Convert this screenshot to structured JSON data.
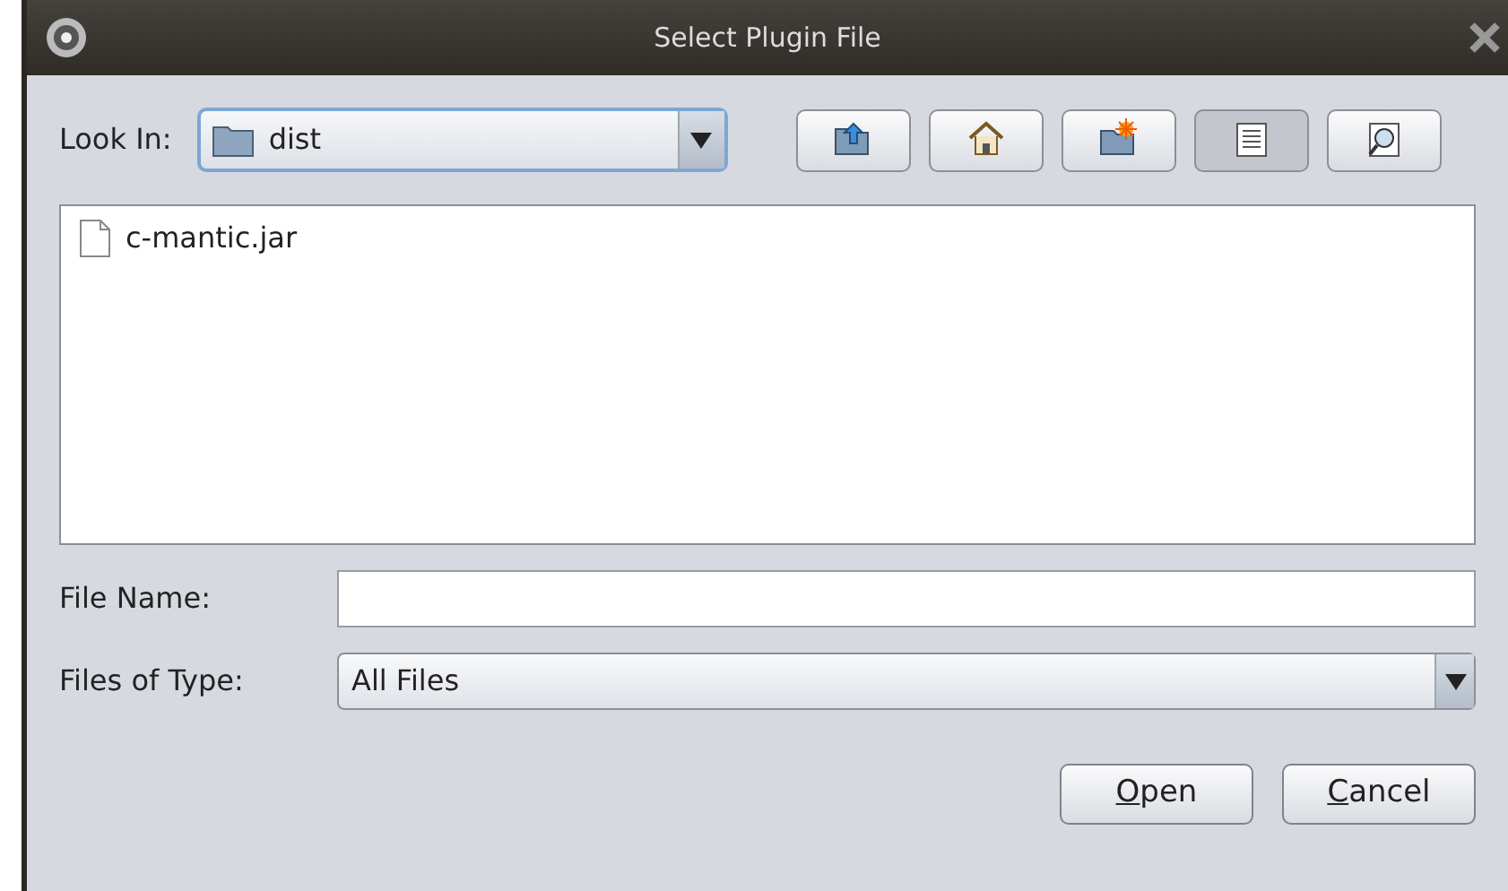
{
  "window": {
    "title": "Select Plugin File"
  },
  "look_in": {
    "label": "Look In:",
    "value": "dist"
  },
  "toolbar": [
    {
      "kind": "up",
      "selected": false
    },
    {
      "kind": "home",
      "selected": false
    },
    {
      "kind": "new-folder",
      "selected": false
    },
    {
      "kind": "list",
      "selected": true
    },
    {
      "kind": "details",
      "selected": false
    }
  ],
  "files": [
    {
      "name": "c-mantic.jar",
      "selected": false
    }
  ],
  "file_name": {
    "label": "File Name:"
  },
  "files_of_type": {
    "label": "Files of Type:",
    "value": "All Files"
  },
  "buttons": [
    {
      "label": "Open",
      "mnemonic": true
    },
    {
      "label": "Cancel",
      "mnemonic": true
    }
  ]
}
